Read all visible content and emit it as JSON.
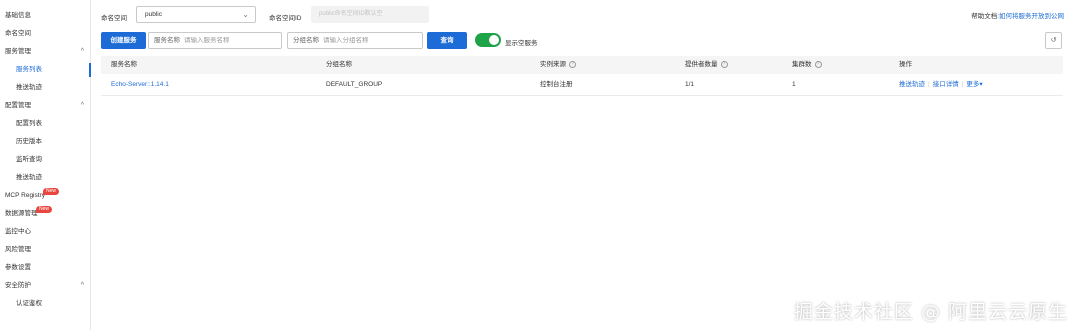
{
  "sidebar": {
    "items": [
      {
        "label": "基础信息",
        "type": "top"
      },
      {
        "label": "命名空间",
        "type": "top"
      },
      {
        "label": "服务管理",
        "type": "group"
      },
      {
        "label": "服务列表",
        "type": "sub",
        "active": true
      },
      {
        "label": "推送轨迹",
        "type": "sub"
      },
      {
        "label": "配置管理",
        "type": "group"
      },
      {
        "label": "配置列表",
        "type": "sub"
      },
      {
        "label": "历史版本",
        "type": "sub"
      },
      {
        "label": "监听查询",
        "type": "sub"
      },
      {
        "label": "推送轨迹",
        "type": "sub"
      },
      {
        "label": "MCP Registry",
        "type": "top",
        "badge": "New"
      },
      {
        "label": "数据源管理",
        "type": "top",
        "badge": "New"
      },
      {
        "label": "监控中心",
        "type": "top"
      },
      {
        "label": "风险管理",
        "type": "top"
      },
      {
        "label": "参数设置",
        "type": "top"
      },
      {
        "label": "安全防护",
        "type": "group"
      },
      {
        "label": "认证鉴权",
        "type": "sub"
      }
    ]
  },
  "topbar": {
    "namespace_label": "命名空间",
    "namespace_value": "public",
    "namespace_id_label": "命名空间ID",
    "namespace_id_placeholder": "public命名空间ID默认空",
    "help_prefix": "帮助文档:",
    "help_link": "如何将服务开放到公网"
  },
  "toolbar": {
    "create_button": "创建服务",
    "service_name_label": "服务名称",
    "service_name_placeholder": "请输入服务名称",
    "group_name_label": "分组名称",
    "group_name_placeholder": "请输入分组名称",
    "query_button": "查询",
    "show_empty_label": "显示空服务",
    "show_empty_on": true,
    "refresh_icon": "refresh-icon"
  },
  "table": {
    "columns": [
      "服务名称",
      "分组名称",
      "实例来源",
      "提供者数量",
      "集群数",
      "操作"
    ],
    "rows": [
      {
        "service_name": "Echo-Server::1.14.1",
        "group_name": "DEFAULT_GROUP",
        "source": "控制台注册",
        "providers": "1/1",
        "clusters": "1",
        "actions": [
          "推送轨迹",
          "接口详情",
          "更多"
        ]
      }
    ]
  },
  "watermark": "掘金技术社区 @ 阿里云云原生",
  "colors": {
    "accent": "#1c6bd6",
    "toggle": "#1fa348",
    "badge": "#e8473f"
  }
}
